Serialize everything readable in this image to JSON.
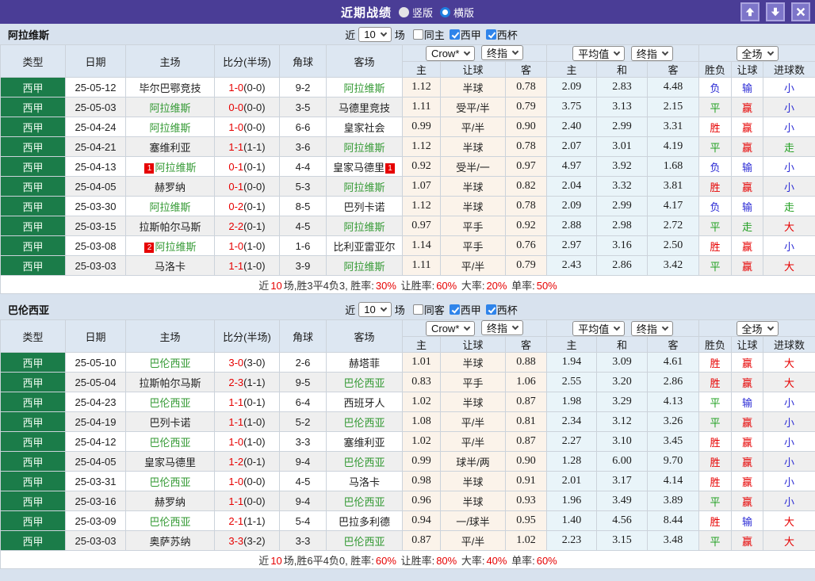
{
  "titlebar": {
    "title": "近期战绩",
    "vertical_label": "竖版",
    "horizontal_label": "横版"
  },
  "controls": {
    "near_label": "近",
    "matches_label": "场"
  },
  "table_header": {
    "type": "类型",
    "date": "日期",
    "home": "主场",
    "score": "比分(半场)",
    "corner": "角球",
    "away": "客场",
    "crow": "Crow*",
    "final": "终指",
    "avg": "平均值",
    "full": "全场",
    "h_home": "主",
    "h_let": "让球",
    "h_away": "客",
    "a_home": "主",
    "a_draw": "和",
    "a_away": "客",
    "r_result": "胜负",
    "r_let": "让球",
    "r_goal": "进球数"
  },
  "sections": [
    {
      "team": "阿拉维斯",
      "recent_count": "10",
      "filters": [
        {
          "label": "同主",
          "checked": false,
          "name": "same-home-checkbox"
        },
        {
          "label": "西甲",
          "checked": true,
          "name": "laliga-checkbox"
        },
        {
          "label": "西杯",
          "checked": true,
          "name": "cup-checkbox"
        }
      ],
      "rows": [
        {
          "type": "西甲",
          "date": "25-05-12",
          "home": "毕尔巴鄂竞技",
          "home_focus": false,
          "home_badge": "",
          "score": "1-0",
          "half": "(0-0)",
          "corner": "9-2",
          "away": "阿拉维斯",
          "away_focus": true,
          "away_badge": "",
          "crow": [
            "1.12",
            "半球",
            "0.78"
          ],
          "avg": [
            "2.09",
            "2.83",
            "4.48"
          ],
          "result": [
            "负",
            "b"
          ],
          "give": [
            "输",
            "b"
          ],
          "goal": [
            "小",
            "b"
          ]
        },
        {
          "type": "西甲",
          "date": "25-05-03",
          "home": "阿拉维斯",
          "home_focus": true,
          "home_badge": "",
          "score": "0-0",
          "half": "(0-0)",
          "corner": "3-5",
          "away": "马德里竞技",
          "away_focus": false,
          "away_badge": "",
          "crow": [
            "1.11",
            "受平/半",
            "0.79"
          ],
          "avg": [
            "3.75",
            "3.13",
            "2.15"
          ],
          "result": [
            "平",
            "g"
          ],
          "give": [
            "赢",
            "r"
          ],
          "goal": [
            "小",
            "b"
          ]
        },
        {
          "type": "西甲",
          "date": "25-04-24",
          "home": "阿拉维斯",
          "home_focus": true,
          "home_badge": "",
          "score": "1-0",
          "half": "(0-0)",
          "corner": "6-6",
          "away": "皇家社会",
          "away_focus": false,
          "away_badge": "",
          "crow": [
            "0.99",
            "平/半",
            "0.90"
          ],
          "avg": [
            "2.40",
            "2.99",
            "3.31"
          ],
          "result": [
            "胜",
            "r"
          ],
          "give": [
            "赢",
            "r"
          ],
          "goal": [
            "小",
            "b"
          ]
        },
        {
          "type": "西甲",
          "date": "25-04-21",
          "home": "塞维利亚",
          "home_focus": false,
          "home_badge": "",
          "score": "1-1",
          "half": "(1-1)",
          "corner": "3-6",
          "away": "阿拉维斯",
          "away_focus": true,
          "away_badge": "",
          "crow": [
            "1.12",
            "半球",
            "0.78"
          ],
          "avg": [
            "2.07",
            "3.01",
            "4.19"
          ],
          "result": [
            "平",
            "g"
          ],
          "give": [
            "赢",
            "r"
          ],
          "goal": [
            "走",
            "g"
          ]
        },
        {
          "type": "西甲",
          "date": "25-04-13",
          "home": "阿拉维斯",
          "home_focus": true,
          "home_badge": "1",
          "score": "0-1",
          "half": "(0-1)",
          "corner": "4-4",
          "away": "皇家马德里",
          "away_focus": false,
          "away_badge": "1",
          "crow": [
            "0.92",
            "受半/一",
            "0.97"
          ],
          "avg": [
            "4.97",
            "3.92",
            "1.68"
          ],
          "result": [
            "负",
            "b"
          ],
          "give": [
            "输",
            "b"
          ],
          "goal": [
            "小",
            "b"
          ]
        },
        {
          "type": "西甲",
          "date": "25-04-05",
          "home": "赫罗纳",
          "home_focus": false,
          "home_badge": "",
          "score": "0-1",
          "half": "(0-0)",
          "corner": "5-3",
          "away": "阿拉维斯",
          "away_focus": true,
          "away_badge": "",
          "crow": [
            "1.07",
            "半球",
            "0.82"
          ],
          "avg": [
            "2.04",
            "3.32",
            "3.81"
          ],
          "result": [
            "胜",
            "r"
          ],
          "give": [
            "赢",
            "r"
          ],
          "goal": [
            "小",
            "b"
          ]
        },
        {
          "type": "西甲",
          "date": "25-03-30",
          "home": "阿拉维斯",
          "home_focus": true,
          "home_badge": "",
          "score": "0-2",
          "half": "(0-1)",
          "corner": "8-5",
          "away": "巴列卡诺",
          "away_focus": false,
          "away_badge": "",
          "crow": [
            "1.12",
            "半球",
            "0.78"
          ],
          "avg": [
            "2.09",
            "2.99",
            "4.17"
          ],
          "result": [
            "负",
            "b"
          ],
          "give": [
            "输",
            "b"
          ],
          "goal": [
            "走",
            "g"
          ]
        },
        {
          "type": "西甲",
          "date": "25-03-15",
          "home": "拉斯帕尔马斯",
          "home_focus": false,
          "home_badge": "",
          "score": "2-2",
          "half": "(0-1)",
          "corner": "4-5",
          "away": "阿拉维斯",
          "away_focus": true,
          "away_badge": "",
          "crow": [
            "0.97",
            "平手",
            "0.92"
          ],
          "avg": [
            "2.88",
            "2.98",
            "2.72"
          ],
          "result": [
            "平",
            "g"
          ],
          "give": [
            "走",
            "g"
          ],
          "goal": [
            "大",
            "r"
          ]
        },
        {
          "type": "西甲",
          "date": "25-03-08",
          "home": "阿拉维斯",
          "home_focus": true,
          "home_badge": "2",
          "score": "1-0",
          "half": "(1-0)",
          "corner": "1-6",
          "away": "比利亚雷亚尔",
          "away_focus": false,
          "away_badge": "",
          "crow": [
            "1.14",
            "平手",
            "0.76"
          ],
          "avg": [
            "2.97",
            "3.16",
            "2.50"
          ],
          "result": [
            "胜",
            "r"
          ],
          "give": [
            "赢",
            "r"
          ],
          "goal": [
            "小",
            "b"
          ]
        },
        {
          "type": "西甲",
          "date": "25-03-03",
          "home": "马洛卡",
          "home_focus": false,
          "home_badge": "",
          "score": "1-1",
          "half": "(1-0)",
          "corner": "3-9",
          "away": "阿拉维斯",
          "away_focus": true,
          "away_badge": "",
          "crow": [
            "1.11",
            "平/半",
            "0.79"
          ],
          "avg": [
            "2.43",
            "2.86",
            "3.42"
          ],
          "result": [
            "平",
            "g"
          ],
          "give": [
            "赢",
            "r"
          ],
          "goal": [
            "大",
            "r"
          ]
        }
      ],
      "summary": [
        [
          "近",
          "k"
        ],
        [
          "10",
          "r"
        ],
        [
          "场,胜3平4负3, 胜率:",
          "k"
        ],
        [
          "30%",
          "r"
        ],
        [
          " 让胜率:",
          "k"
        ],
        [
          "60%",
          "r"
        ],
        [
          " 大率:",
          "k"
        ],
        [
          "20%",
          "r"
        ],
        [
          " 单率:",
          "k"
        ],
        [
          "50%",
          "r"
        ]
      ]
    },
    {
      "team": "巴伦西亚",
      "recent_count": "10",
      "filters": [
        {
          "label": "同客",
          "checked": false,
          "name": "same-away-checkbox"
        },
        {
          "label": "西甲",
          "checked": true,
          "name": "laliga-checkbox"
        },
        {
          "label": "西杯",
          "checked": true,
          "name": "cup-checkbox"
        }
      ],
      "rows": [
        {
          "type": "西甲",
          "date": "25-05-10",
          "home": "巴伦西亚",
          "home_focus": true,
          "home_badge": "",
          "score": "3-0",
          "half": "(3-0)",
          "corner": "2-6",
          "away": "赫塔菲",
          "away_focus": false,
          "away_badge": "",
          "crow": [
            "1.01",
            "半球",
            "0.88"
          ],
          "avg": [
            "1.94",
            "3.09",
            "4.61"
          ],
          "result": [
            "胜",
            "r"
          ],
          "give": [
            "赢",
            "r"
          ],
          "goal": [
            "大",
            "r"
          ]
        },
        {
          "type": "西甲",
          "date": "25-05-04",
          "home": "拉斯帕尔马斯",
          "home_focus": false,
          "home_badge": "",
          "score": "2-3",
          "half": "(1-1)",
          "corner": "9-5",
          "away": "巴伦西亚",
          "away_focus": true,
          "away_badge": "",
          "crow": [
            "0.83",
            "平手",
            "1.06"
          ],
          "avg": [
            "2.55",
            "3.20",
            "2.86"
          ],
          "result": [
            "胜",
            "r"
          ],
          "give": [
            "赢",
            "r"
          ],
          "goal": [
            "大",
            "r"
          ]
        },
        {
          "type": "西甲",
          "date": "25-04-23",
          "home": "巴伦西亚",
          "home_focus": true,
          "home_badge": "",
          "score": "1-1",
          "half": "(0-1)",
          "corner": "6-4",
          "away": "西班牙人",
          "away_focus": false,
          "away_badge": "",
          "crow": [
            "1.02",
            "半球",
            "0.87"
          ],
          "avg": [
            "1.98",
            "3.29",
            "4.13"
          ],
          "result": [
            "平",
            "g"
          ],
          "give": [
            "输",
            "b"
          ],
          "goal": [
            "小",
            "b"
          ]
        },
        {
          "type": "西甲",
          "date": "25-04-19",
          "home": "巴列卡诺",
          "home_focus": false,
          "home_badge": "",
          "score": "1-1",
          "half": "(1-0)",
          "corner": "5-2",
          "away": "巴伦西亚",
          "away_focus": true,
          "away_badge": "",
          "crow": [
            "1.08",
            "平/半",
            "0.81"
          ],
          "avg": [
            "2.34",
            "3.12",
            "3.26"
          ],
          "result": [
            "平",
            "g"
          ],
          "give": [
            "赢",
            "r"
          ],
          "goal": [
            "小",
            "b"
          ]
        },
        {
          "type": "西甲",
          "date": "25-04-12",
          "home": "巴伦西亚",
          "home_focus": true,
          "home_badge": "",
          "score": "1-0",
          "half": "(1-0)",
          "corner": "3-3",
          "away": "塞维利亚",
          "away_focus": false,
          "away_badge": "",
          "crow": [
            "1.02",
            "平/半",
            "0.87"
          ],
          "avg": [
            "2.27",
            "3.10",
            "3.45"
          ],
          "result": [
            "胜",
            "r"
          ],
          "give": [
            "赢",
            "r"
          ],
          "goal": [
            "小",
            "b"
          ]
        },
        {
          "type": "西甲",
          "date": "25-04-05",
          "home": "皇家马德里",
          "home_focus": false,
          "home_badge": "",
          "score": "1-2",
          "half": "(0-1)",
          "corner": "9-4",
          "away": "巴伦西亚",
          "away_focus": true,
          "away_badge": "",
          "crow": [
            "0.99",
            "球半/两",
            "0.90"
          ],
          "avg": [
            "1.28",
            "6.00",
            "9.70"
          ],
          "result": [
            "胜",
            "r"
          ],
          "give": [
            "赢",
            "r"
          ],
          "goal": [
            "小",
            "b"
          ]
        },
        {
          "type": "西甲",
          "date": "25-03-31",
          "home": "巴伦西亚",
          "home_focus": true,
          "home_badge": "",
          "score": "1-0",
          "half": "(0-0)",
          "corner": "4-5",
          "away": "马洛卡",
          "away_focus": false,
          "away_badge": "",
          "crow": [
            "0.98",
            "半球",
            "0.91"
          ],
          "avg": [
            "2.01",
            "3.17",
            "4.14"
          ],
          "result": [
            "胜",
            "r"
          ],
          "give": [
            "赢",
            "r"
          ],
          "goal": [
            "小",
            "b"
          ]
        },
        {
          "type": "西甲",
          "date": "25-03-16",
          "home": "赫罗纳",
          "home_focus": false,
          "home_badge": "",
          "score": "1-1",
          "half": "(0-0)",
          "corner": "9-4",
          "away": "巴伦西亚",
          "away_focus": true,
          "away_badge": "",
          "crow": [
            "0.96",
            "半球",
            "0.93"
          ],
          "avg": [
            "1.96",
            "3.49",
            "3.89"
          ],
          "result": [
            "平",
            "g"
          ],
          "give": [
            "赢",
            "r"
          ],
          "goal": [
            "小",
            "b"
          ]
        },
        {
          "type": "西甲",
          "date": "25-03-09",
          "home": "巴伦西亚",
          "home_focus": true,
          "home_badge": "",
          "score": "2-1",
          "half": "(1-1)",
          "corner": "5-4",
          "away": "巴拉多利德",
          "away_focus": false,
          "away_badge": "",
          "crow": [
            "0.94",
            "一/球半",
            "0.95"
          ],
          "avg": [
            "1.40",
            "4.56",
            "8.44"
          ],
          "result": [
            "胜",
            "r"
          ],
          "give": [
            "输",
            "b"
          ],
          "goal": [
            "大",
            "r"
          ]
        },
        {
          "type": "西甲",
          "date": "25-03-03",
          "home": "奥萨苏纳",
          "home_focus": false,
          "home_badge": "",
          "score": "3-3",
          "half": "(3-2)",
          "corner": "3-3",
          "away": "巴伦西亚",
          "away_focus": true,
          "away_badge": "",
          "crow": [
            "0.87",
            "平/半",
            "1.02"
          ],
          "avg": [
            "2.23",
            "3.15",
            "3.48"
          ],
          "result": [
            "平",
            "g"
          ],
          "give": [
            "赢",
            "r"
          ],
          "goal": [
            "大",
            "r"
          ]
        }
      ],
      "summary": [
        [
          "近",
          "k"
        ],
        [
          "10",
          "r"
        ],
        [
          "场,胜6平4负0, 胜率:",
          "k"
        ],
        [
          "60%",
          "r"
        ],
        [
          " 让胜率:",
          "k"
        ],
        [
          "80%",
          "r"
        ],
        [
          " 大率:",
          "k"
        ],
        [
          "40%",
          "r"
        ],
        [
          " 单率:",
          "k"
        ],
        [
          "60%",
          "r"
        ]
      ]
    }
  ]
}
